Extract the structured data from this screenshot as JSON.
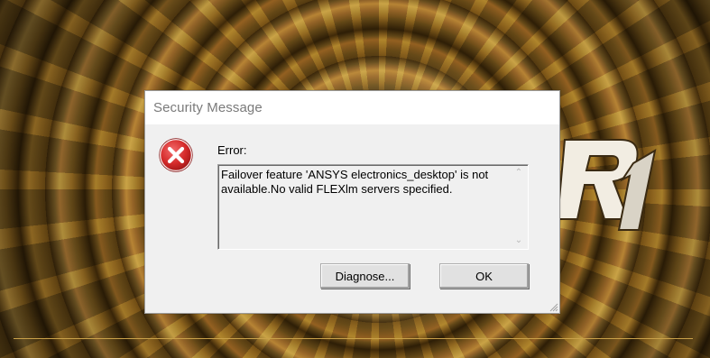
{
  "dialog": {
    "title": "Security Message",
    "error_label": "Error:",
    "message": "Failover feature 'ANSYS electronics_desktop' is not available.No valid FLEXlm servers specified.",
    "buttons": {
      "diagnose": "Diagnose...",
      "ok": "OK"
    },
    "icon": "error-icon"
  },
  "background": {
    "release_mark": "R1"
  },
  "colors": {
    "error_red": "#c7262b",
    "dialog_bg": "#f0f0f0",
    "accent_gold": "#c9a14a"
  }
}
